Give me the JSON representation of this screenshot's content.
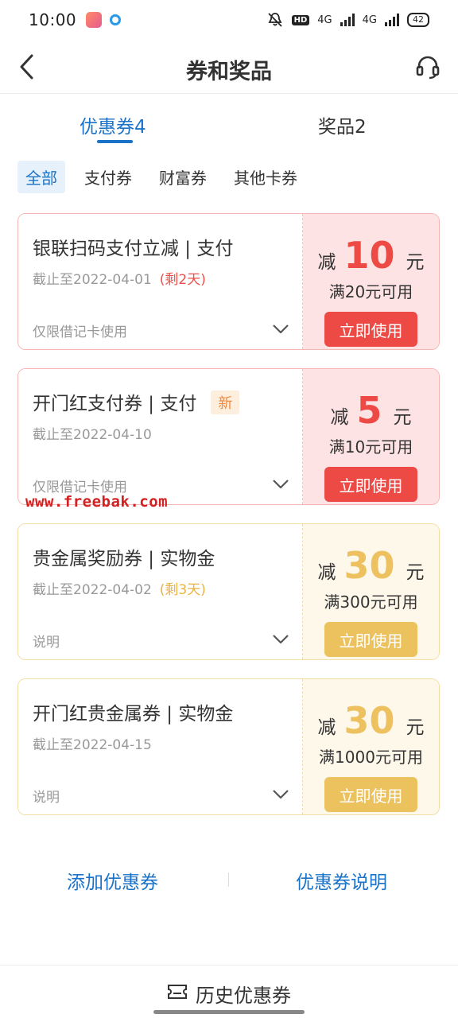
{
  "status_bar": {
    "time": "10:00",
    "hd_label": "HD",
    "net_label_1": "4G",
    "net_label_2": "4G",
    "battery": "42"
  },
  "nav": {
    "title": "券和奖品"
  },
  "tabs": [
    {
      "label": "优惠券4",
      "active": true
    },
    {
      "label": "奖品2",
      "active": false
    }
  ],
  "filters": [
    {
      "label": "全部",
      "active": true
    },
    {
      "label": "支付券",
      "active": false
    },
    {
      "label": "财富券",
      "active": false
    },
    {
      "label": "其他卡券",
      "active": false
    }
  ],
  "coupons": [
    {
      "title": "银联扫码支付立减 | 支付",
      "badge": "",
      "expiry": "截止至2022-04-01",
      "remaining": "(剩2天)",
      "note": "仅限借记卡使用",
      "amount_prefix": "减",
      "amount": "10",
      "amount_suffix": "元",
      "threshold": "满20元可用",
      "button": "立即使用",
      "theme": "red"
    },
    {
      "title": "开门红支付券 | 支付",
      "badge": "新",
      "expiry": "截止至2022-04-10",
      "remaining": "",
      "note": "仅限借记卡使用",
      "amount_prefix": "减",
      "amount": "5",
      "amount_suffix": "元",
      "threshold": "满10元可用",
      "button": "立即使用",
      "theme": "red"
    },
    {
      "title": "贵金属奖励券 | 实物金",
      "badge": "",
      "expiry": "截止至2022-04-02",
      "remaining": "(剩3天)",
      "note": "说明",
      "amount_prefix": "减",
      "amount": "30",
      "amount_suffix": "元",
      "threshold": "满300元可用",
      "button": "立即使用",
      "theme": "gold"
    },
    {
      "title": "开门红贵金属券 | 实物金",
      "badge": "",
      "expiry": "截止至2022-04-15",
      "remaining": "",
      "note": "说明",
      "amount_prefix": "减",
      "amount": "30",
      "amount_suffix": "元",
      "threshold": "满1000元可用",
      "button": "立即使用",
      "theme": "gold"
    }
  ],
  "watermark": "www.freebak.com",
  "footer": {
    "add_coupon": "添加优惠券",
    "coupon_info": "优惠券说明",
    "history": "历史优惠券"
  },
  "colors": {
    "accent_blue": "#1a73c9",
    "coupon_red": "#ee4a45",
    "coupon_gold": "#ebc25e"
  }
}
